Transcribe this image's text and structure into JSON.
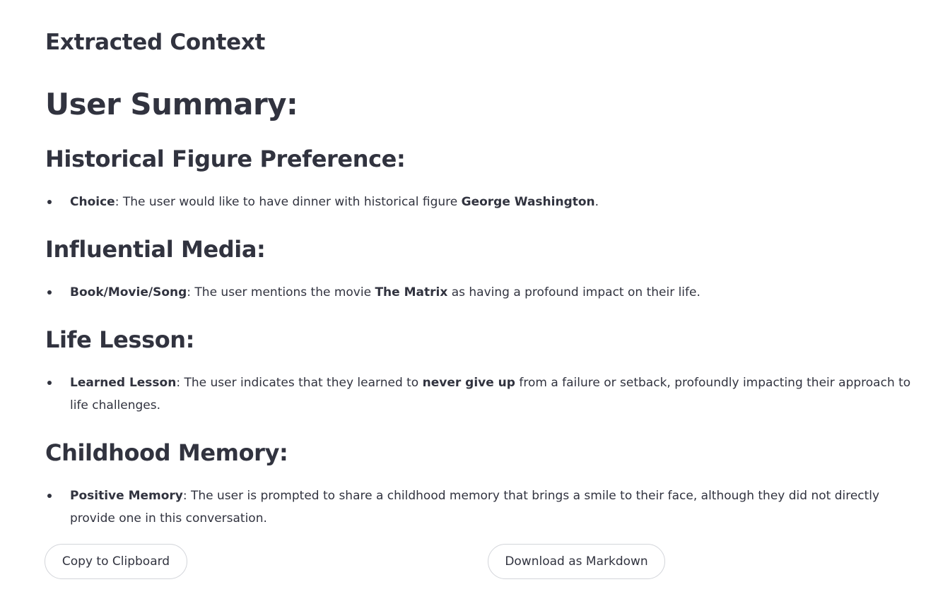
{
  "header": {
    "title": "Extracted Context"
  },
  "summary": {
    "title": "User Summary:"
  },
  "sections": [
    {
      "title": "Historical Figure Preference:",
      "item": {
        "label": "Choice",
        "t1": ": The user would like to have dinner with historical figure ",
        "b1": "George Washington",
        "t2": "."
      }
    },
    {
      "title": "Influential Media:",
      "item": {
        "label": "Book/Movie/Song",
        "t1": ": The user mentions the movie ",
        "b1": "The Matrix",
        "t2": " as having a profound impact on their life."
      }
    },
    {
      "title": "Life Lesson:",
      "item": {
        "label": "Learned Lesson",
        "t1": ": The user indicates that they learned to ",
        "b1": "never give up",
        "t2": " from a failure or setback, profoundly impacting their approach to life challenges."
      }
    },
    {
      "title": "Childhood Memory:",
      "item": {
        "label": "Positive Memory",
        "t1": ": The user is prompted to share a childhood memory that brings a smile to their face, although they did not directly provide one in this conversation."
      }
    }
  ],
  "actions": {
    "copy_label": "Copy to Clipboard",
    "download_label": "Download as Markdown"
  }
}
